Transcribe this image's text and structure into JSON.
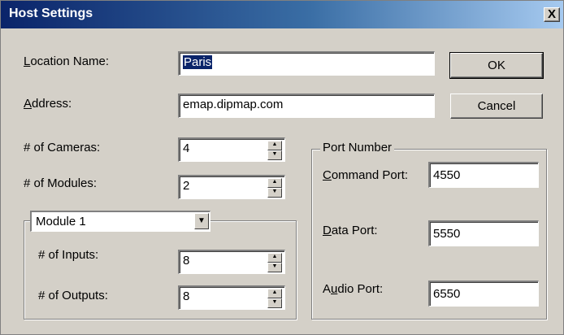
{
  "window": {
    "title": "Host Settings",
    "close_glyph": "X"
  },
  "location": {
    "label_u": "L",
    "label_rest": "ocation Name:",
    "value": "Paris"
  },
  "address": {
    "label_u": "A",
    "label_rest": "ddress:",
    "value": "emap.dipmap.com"
  },
  "buttons": {
    "ok": "OK",
    "cancel": "Cancel"
  },
  "cameras": {
    "label": "# of Cameras:",
    "value": "4"
  },
  "modules": {
    "label": "# of Modules:",
    "value": "2"
  },
  "module_group": {
    "selected": "Module 1",
    "inputs_label": "# of Inputs:",
    "inputs_value": "8",
    "outputs_label": "# of Outputs:",
    "outputs_value": "8"
  },
  "ports": {
    "legend": "Port Number",
    "command_u": "C",
    "command_rest": "ommand Port:",
    "command_value": "4550",
    "data_u": "D",
    "data_rest": "ata Port:",
    "data_value": "5550",
    "audio_pre": "A",
    "audio_u": "u",
    "audio_rest": "dio Port:",
    "audio_value": "6550"
  },
  "spin_glyphs": {
    "up": "▲",
    "down": "▼"
  },
  "dropdown_glyph": "▼"
}
